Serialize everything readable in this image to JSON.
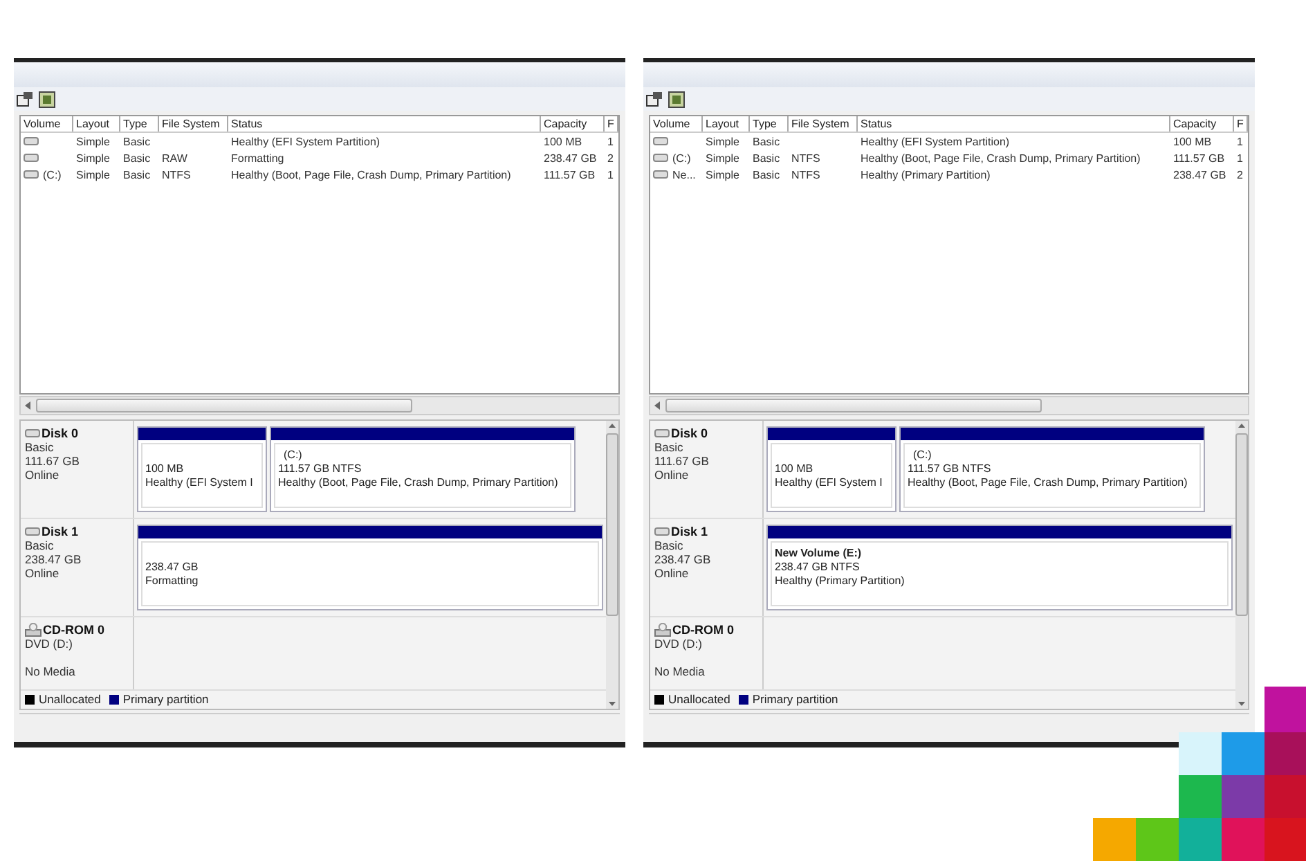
{
  "panels": [
    {
      "table": {
        "columns": [
          "Volume",
          "Layout",
          "Type",
          "File System",
          "Status",
          "Capacity",
          "F"
        ],
        "rows": [
          {
            "layout": "Simple",
            "type": "Basic",
            "status": "Healthy (EFI System Partition)",
            "capacity": "100 MB",
            "column_7": "1"
          },
          {
            "layout": "Simple",
            "type": "Basic",
            "file_system": "RAW",
            "status": "Formatting",
            "capacity": "238.47 GB",
            "column_7": "2"
          },
          {
            "volume": "(C:)",
            "layout": "Simple",
            "type": "Basic",
            "file_system": "NTFS",
            "status": "Healthy (Boot, Page File, Crash Dump, Primary Partition)",
            "capacity": "111.57 GB",
            "column_7": "1"
          }
        ]
      },
      "disks": [
        {
          "kind": "disk",
          "name": "Disk 0",
          "info": [
            "Basic",
            "111.67 GB",
            "Online"
          ],
          "partitions": [
            {
              "lines": [
                "100 MB",
                "Healthy (EFI System I"
              ]
            },
            {
              "label": "(C:)",
              "label_bold": false,
              "lines": [
                "111.57 GB NTFS",
                "Healthy (Boot, Page File, Crash Dump, Primary Partition)"
              ]
            }
          ]
        },
        {
          "kind": "disk",
          "name": "Disk 1",
          "info": [
            "Basic",
            "238.47 GB",
            "Online"
          ],
          "partitions": [
            {
              "lines": [
                "238.47 GB",
                "Formatting"
              ]
            }
          ]
        },
        {
          "kind": "cdrom",
          "name": "CD-ROM 0",
          "info": [
            "DVD (D:)",
            "No Media"
          ]
        }
      ],
      "legend": [
        {
          "label": "Unallocated",
          "color": "#000000"
        },
        {
          "label": "Primary partition",
          "color": "#000080"
        }
      ]
    },
    {
      "table": {
        "columns": [
          "Volume",
          "Layout",
          "Type",
          "File System",
          "Status",
          "Capacity",
          "F"
        ],
        "rows": [
          {
            "layout": "Simple",
            "type": "Basic",
            "status": "Healthy (EFI System Partition)",
            "capacity": "100 MB",
            "column_7": "1"
          },
          {
            "volume": "(C:)",
            "layout": "Simple",
            "type": "Basic",
            "file_system": "NTFS",
            "status": "Healthy (Boot, Page File, Crash Dump, Primary Partition)",
            "capacity": "111.57 GB",
            "column_7": "1"
          },
          {
            "volume": "Ne...",
            "layout": "Simple",
            "type": "Basic",
            "file_system": "NTFS",
            "status": "Healthy (Primary Partition)",
            "capacity": "238.47 GB",
            "column_7": "2"
          }
        ]
      },
      "disks": [
        {
          "kind": "disk",
          "name": "Disk 0",
          "info": [
            "Basic",
            "111.67 GB",
            "Online"
          ],
          "partitions": [
            {
              "lines": [
                "100 MB",
                "Healthy (EFI System I"
              ]
            },
            {
              "label": "(C:)",
              "label_bold": false,
              "lines": [
                "111.57 GB NTFS",
                "Healthy (Boot, Page File, Crash Dump, Primary Partition)"
              ]
            }
          ]
        },
        {
          "kind": "disk",
          "name": "Disk 1",
          "info": [
            "Basic",
            "238.47 GB",
            "Online"
          ],
          "partitions": [
            {
              "label": "New Volume  (E:)",
              "label_bold": true,
              "lines": [
                "238.47 GB NTFS",
                "Healthy (Primary Partition)"
              ]
            }
          ]
        },
        {
          "kind": "cdrom",
          "name": "CD-ROM 0",
          "info": [
            "DVD (D:)",
            "No Media"
          ]
        }
      ],
      "legend": [
        {
          "label": "Unallocated",
          "color": "#000000"
        },
        {
          "label": "Primary partition",
          "color": "#000080"
        }
      ]
    }
  ]
}
